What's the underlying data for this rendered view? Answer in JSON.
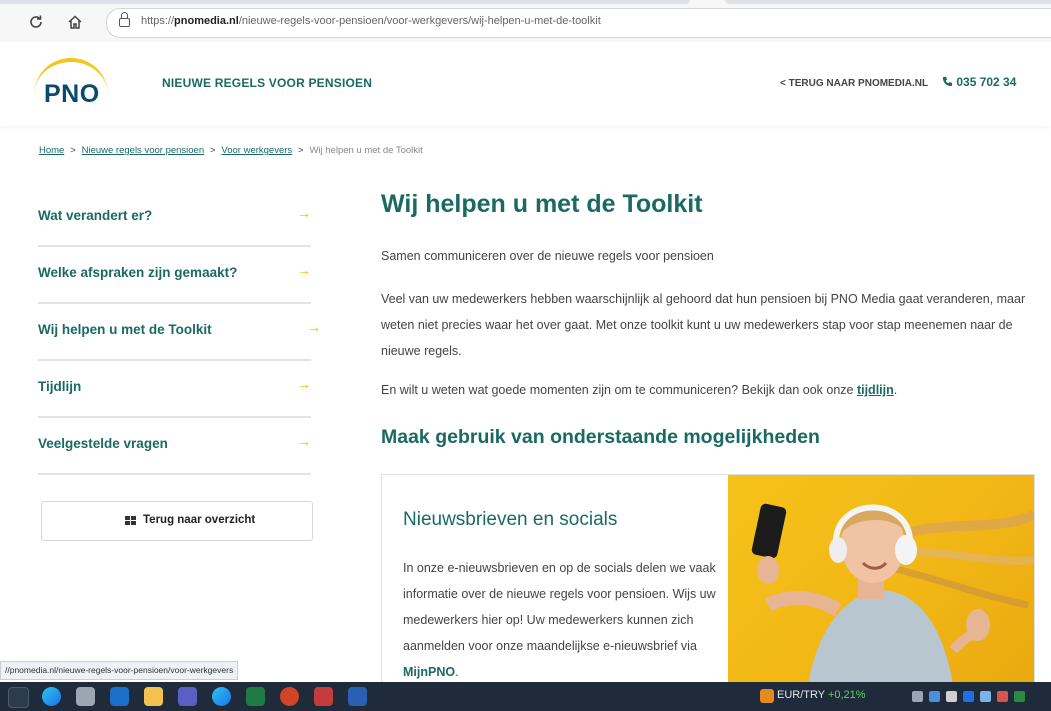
{
  "browser": {
    "url_prefix": "https://",
    "url_domain": "pnomedia.nl",
    "url_path": "/nieuwe-regels-voor-pensioen/voor-werkgevers/wij-helpen-u-met-de-toolkit",
    "status_url": "//pnomedia.nl/nieuwe-regels-voor-pensioen/voor-werkgevers"
  },
  "header": {
    "logo_text": "PNO",
    "site_title": "NIEUWE REGELS VOOR PENSIOEN",
    "back_link": "< TERUG NAAR PNOMEDIA.NL",
    "phone": "035 702 34"
  },
  "breadcrumb": {
    "items": [
      "Home",
      "Nieuwe regels voor pensioen",
      "Voor werkgevers"
    ],
    "current": "Wij helpen u met de Toolkit",
    "separator": ">"
  },
  "sidebar": {
    "items": [
      {
        "label": "Wat verandert er?",
        "arrow": "→"
      },
      {
        "label": "Welke afspraken zijn gemaakt?",
        "arrow": "→"
      },
      {
        "label": "Wij helpen u met de Toolkit",
        "arrow": "→"
      },
      {
        "label": "Tijdlijn",
        "arrow": "→"
      },
      {
        "label": "Veelgestelde vragen",
        "arrow": "→"
      }
    ],
    "overview_button": "Terug naar overzicht"
  },
  "main": {
    "title": "Wij helpen u met de Toolkit",
    "intro": "Samen communiceren over de nieuwe regels voor pensioen",
    "body": "Veel van uw medewerkers hebben waarschijnlijk al gehoord dat hun pensioen bij PNO Media gaat veranderen, maar weten niet precies waar het over gaat. Met onze toolkit kunt u uw medewerkers stap voor stap meenemen naar de nieuwe regels.",
    "timeline_text": "En wilt u weten wat goede momenten zijn om te communiceren? Bekijk dan ook onze ",
    "timeline_link": "tijdlijn",
    "timeline_end": ".",
    "subtitle": "Maak gebruik van onderstaande mogelijkheden"
  },
  "card": {
    "title": "Nieuwsbrieven en socials",
    "text": "In onze e-nieuwsbrieven en op de socials delen we vaak informatie over de nieuwe regels voor pensioen. Wijs uw medewerkers hier op! Uw medewerkers kunnen zich aanmelden voor onze maandelijkse e-nieuwsbrief via ",
    "link": "MijnPNO",
    "text_end": "."
  },
  "taskbar": {
    "ticker_label": "EUR/TRY",
    "ticker_change": "+0,21%"
  },
  "colors": {
    "brand_teal": "#1a6a63",
    "accent_yellow": "#f5b400",
    "logo_blue": "#0a4a6e"
  }
}
